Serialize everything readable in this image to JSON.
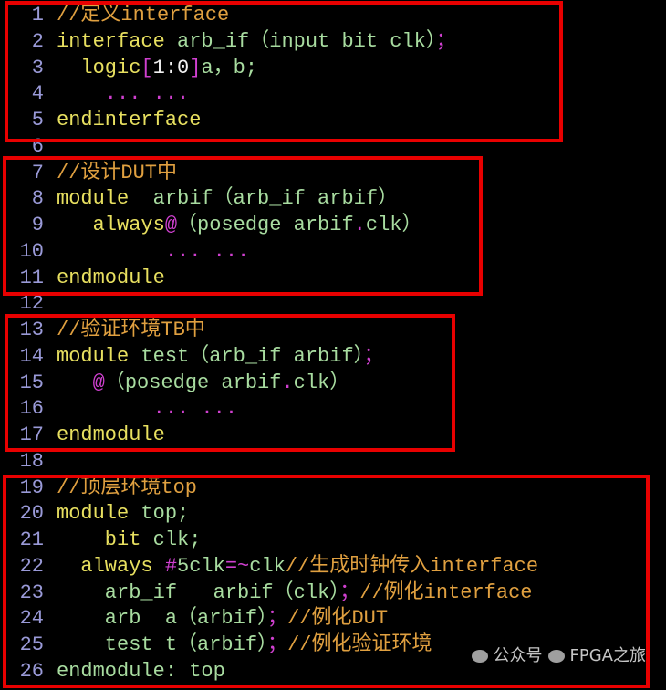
{
  "colors": {
    "keyword": "#e8e060",
    "identifier": "#a8dca0",
    "comment": "#e0a040",
    "punct": "#d040d0",
    "number": "#f0f0f0",
    "line_number": "#9a9ad8",
    "highlight_box": "#e80000",
    "background": "#000000"
  },
  "lines": [
    [
      [
        "//定义interface",
        "cm"
      ]
    ],
    [
      [
        "interface",
        "kw"
      ],
      [
        " arb_if（input bit clk）",
        "id"
      ],
      [
        "；",
        "pu"
      ]
    ],
    [
      [
        "  logic",
        "kw"
      ],
      [
        "[",
        "pu"
      ],
      [
        "1:0",
        "nu"
      ],
      [
        "]",
        "pu"
      ],
      [
        "a，b;",
        "id"
      ]
    ],
    [
      [
        "    ... ...",
        "pu"
      ]
    ],
    [
      [
        "endinterface",
        "kw"
      ]
    ],
    [],
    [
      [
        "//设计DUT中",
        "cm"
      ]
    ],
    [
      [
        "module",
        "kw"
      ],
      [
        "  arbif（arb_if arbif）",
        "id"
      ]
    ],
    [
      [
        "   always",
        "kw"
      ],
      [
        "@",
        "pu"
      ],
      [
        "（posedge arbif",
        "id"
      ],
      [
        ".",
        "pu"
      ],
      [
        "clk）",
        "id"
      ]
    ],
    [
      [
        "         ... ...",
        "pu"
      ]
    ],
    [
      [
        "endmodule",
        "kw"
      ]
    ],
    [],
    [
      [
        "//验证环境TB中",
        "cm"
      ]
    ],
    [
      [
        "module",
        "kw"
      ],
      [
        " test（arb_if arbif）",
        "id"
      ],
      [
        "；",
        "pu"
      ]
    ],
    [
      [
        "   @",
        "pu"
      ],
      [
        "（posedge arbif",
        "id"
      ],
      [
        ".",
        "pu"
      ],
      [
        "clk）",
        "id"
      ]
    ],
    [
      [
        "        ... ...",
        "pu"
      ]
    ],
    [
      [
        "endmodule",
        "kw"
      ]
    ],
    [],
    [
      [
        "//顶层环境top",
        "cm"
      ]
    ],
    [
      [
        "module",
        "kw"
      ],
      [
        " top;",
        "id"
      ]
    ],
    [
      [
        "    bit",
        "kw"
      ],
      [
        " clk;",
        "id"
      ]
    ],
    [
      [
        "  always",
        "kw"
      ],
      [
        " #",
        "pu"
      ],
      [
        "5clk",
        "id"
      ],
      [
        "=~",
        "pu"
      ],
      [
        "clk",
        "id"
      ],
      [
        "//生成时钟传入interface",
        "cm"
      ]
    ],
    [
      [
        "    arb_if   arbif（clk）",
        "id"
      ],
      [
        "；",
        "pu"
      ],
      [
        "//例化interface",
        "cm"
      ]
    ],
    [
      [
        "    arb  a（arbif）",
        "id"
      ],
      [
        "；",
        "pu"
      ],
      [
        "//例化DUT",
        "cm"
      ]
    ],
    [
      [
        "    test t（arbif）",
        "id"
      ],
      [
        "；",
        "pu"
      ],
      [
        "//例化验证环境",
        "cm"
      ]
    ],
    [
      [
        "endmodule: top",
        "id"
      ]
    ]
  ],
  "watermark": {
    "prefix": "公众号",
    "name": "FPGA之旅"
  }
}
